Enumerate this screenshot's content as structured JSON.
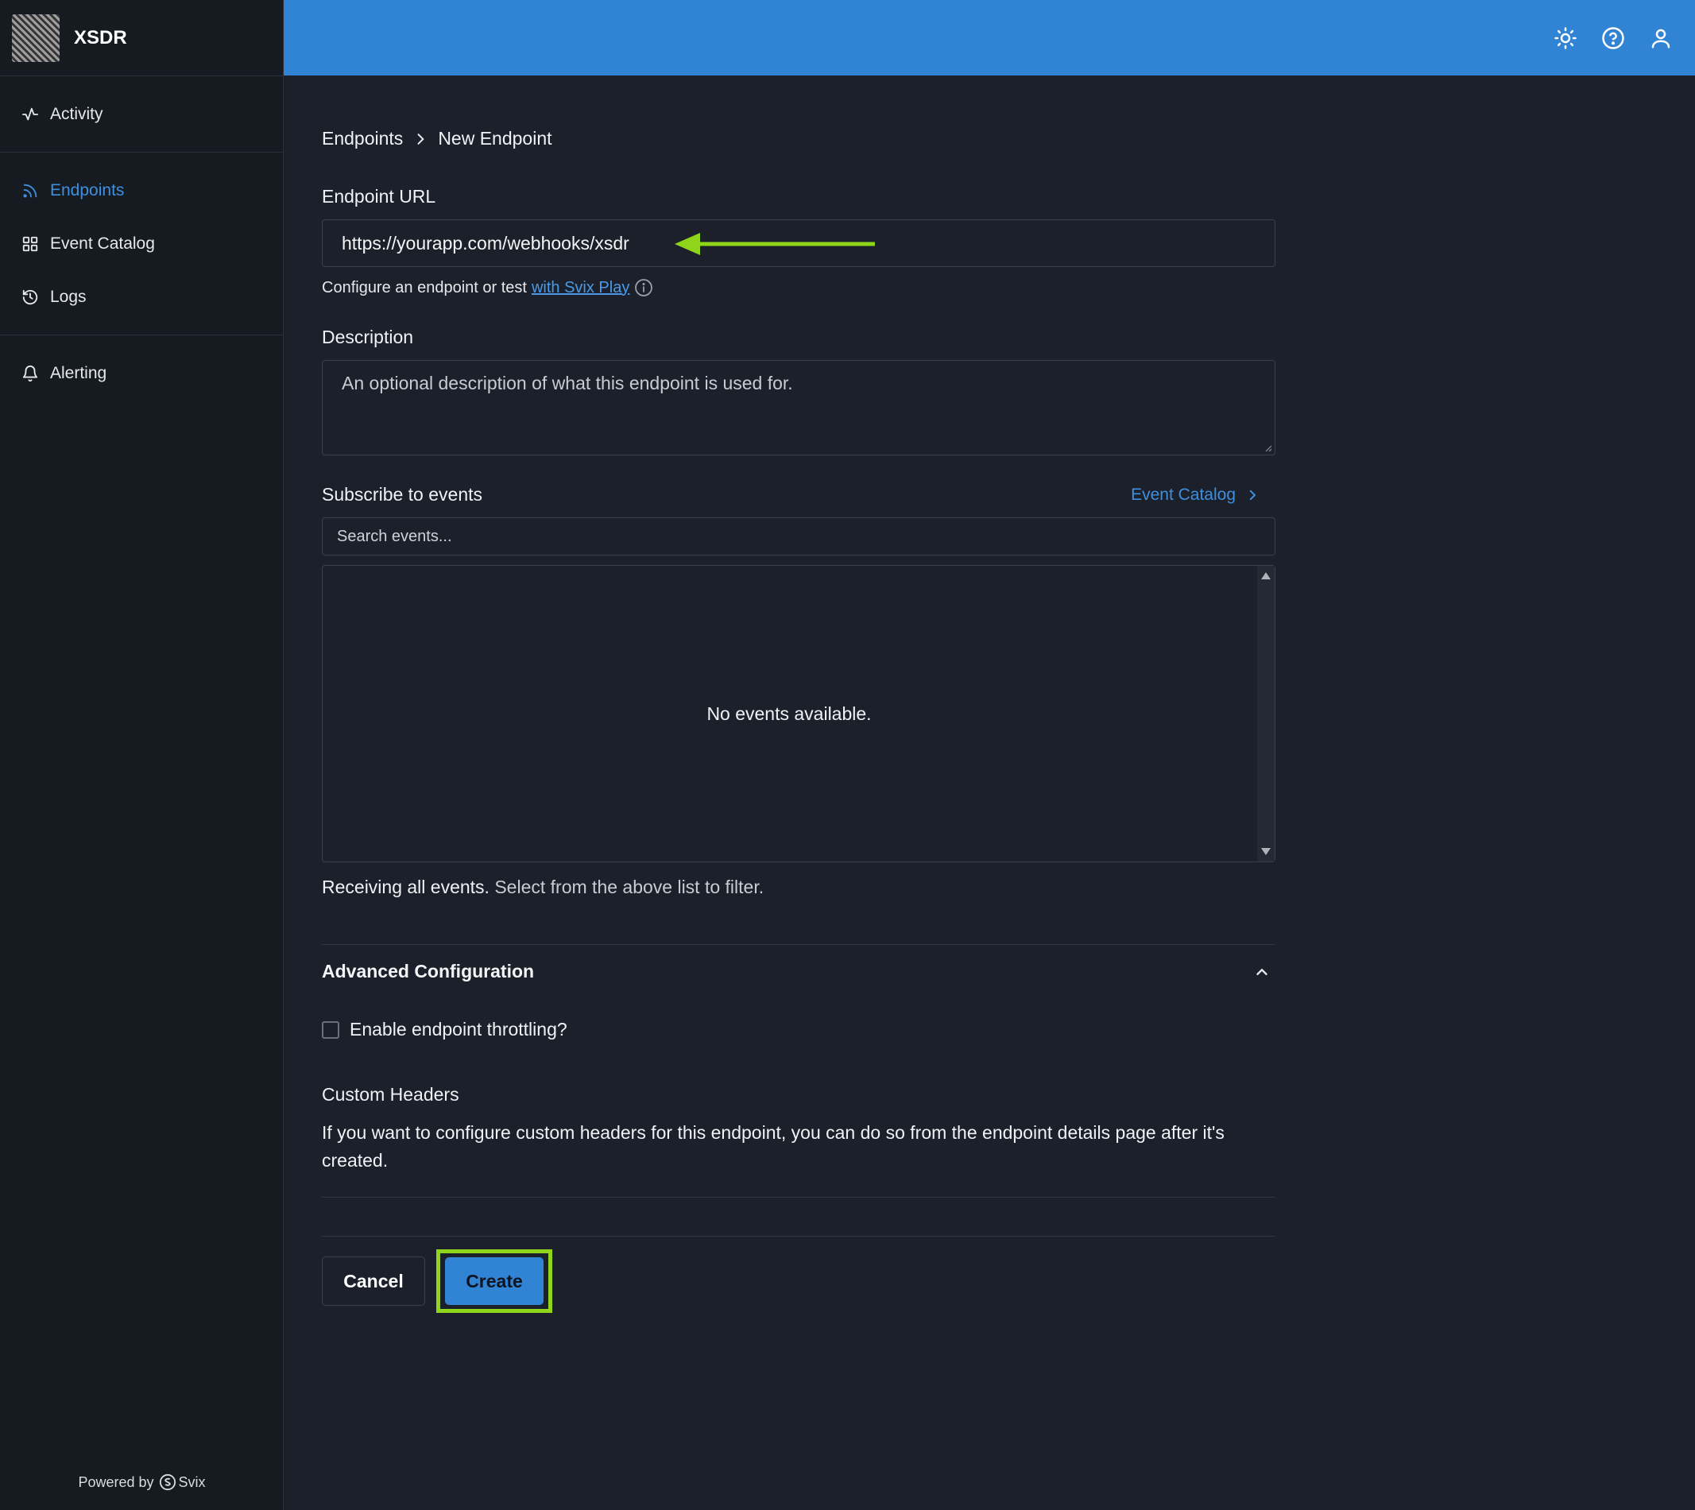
{
  "app": {
    "name": "XSDR"
  },
  "sidebar": {
    "groups": [
      [
        {
          "label": "Activity",
          "icon": "activity-icon"
        }
      ],
      [
        {
          "label": "Endpoints",
          "icon": "rss-icon",
          "active": true
        },
        {
          "label": "Event Catalog",
          "icon": "grid-icon"
        },
        {
          "label": "Logs",
          "icon": "history-icon"
        }
      ],
      [
        {
          "label": "Alerting",
          "icon": "bell-icon"
        }
      ]
    ],
    "powered_prefix": "Powered by",
    "powered_brand": "Svix"
  },
  "topbar": {
    "icons": [
      "theme-toggle-icon",
      "help-icon",
      "user-icon"
    ]
  },
  "breadcrumb": {
    "parent": "Endpoints",
    "current": "New Endpoint"
  },
  "form": {
    "url_label": "Endpoint URL",
    "url_placeholder": "https://yourapp.com/webhooks/xsdr",
    "url_hint": "Configure an endpoint or test",
    "url_hint_link": "with Svix Play",
    "description_label": "Description",
    "description_placeholder": "An optional description of what this endpoint is used for.",
    "subscribe_label": "Subscribe to events",
    "event_catalog_link": "Event Catalog",
    "search_placeholder": "Search events...",
    "no_events": "No events available.",
    "receiving_strong": "Receiving all events.",
    "receiving_rest": " Select from the above list to filter.",
    "advanced_title": "Advanced Configuration",
    "throttle_label": "Enable endpoint throttling?",
    "custom_headers_title": "Custom Headers",
    "custom_headers_text": "If you want to configure custom headers for this endpoint, you can do so from the endpoint details page after it's created.",
    "cancel_label": "Cancel",
    "create_label": "Create"
  },
  "colors": {
    "accent": "#3184d3",
    "highlight": "#8fd61a",
    "background": "#1b202a"
  }
}
